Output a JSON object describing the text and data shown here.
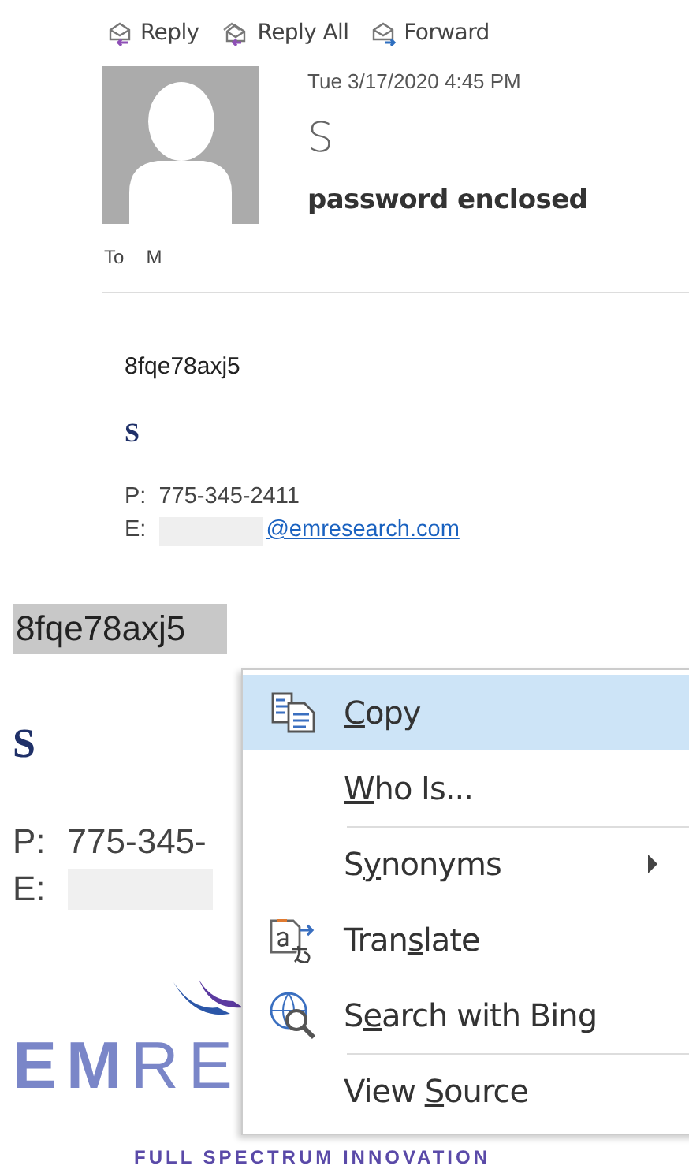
{
  "toolbar": [
    {
      "label": "Reply",
      "kind": "reply"
    },
    {
      "label": "Reply All",
      "kind": "reply_all"
    },
    {
      "label": "Forward",
      "kind": "forward"
    }
  ],
  "message": {
    "date": "Tue 3/17/2020 4:45 PM",
    "sender": "S",
    "subject": "password enclosed",
    "to_label": "To",
    "to": "M"
  },
  "body": {
    "text": "8fqe78axj5",
    "signature_name": "S",
    "phone_label": "P:",
    "phone": "775-345-2411",
    "email_label": "E:",
    "email": "@emresearch.com"
  },
  "zoom": {
    "selected_text": "8fqe78axj5",
    "signature_name": "S",
    "phone_label": "P:",
    "phone": "775-345-",
    "email_label": "E:",
    "logo_text": "**EM**RE",
    "tagline": "FULL SPECTRUM INNOVATION"
  },
  "context_menu": [
    {
      "key": "C",
      "after": "opy",
      "selected": true,
      "submenu": false,
      "separator_before": false
    },
    {
      "key": "W",
      "after": "ho Is...",
      "selected": false,
      "submenu": false,
      "separator_before": false
    },
    {
      "before": "S",
      "key": "y",
      "after": "nonyms",
      "selected": false,
      "submenu": true,
      "separator_before": true
    },
    {
      "before": "Tran",
      "key": "s",
      "after": "late",
      "selected": false,
      "submenu": false,
      "separator_before": false
    },
    {
      "before": "S",
      "key": "e",
      "after": "arch with Bing",
      "selected": false,
      "submenu": false,
      "separator_before": false
    },
    {
      "before": "View ",
      "key": "S",
      "after": "ource",
      "selected": false,
      "submenu": false,
      "separator_before": true
    }
  ]
}
